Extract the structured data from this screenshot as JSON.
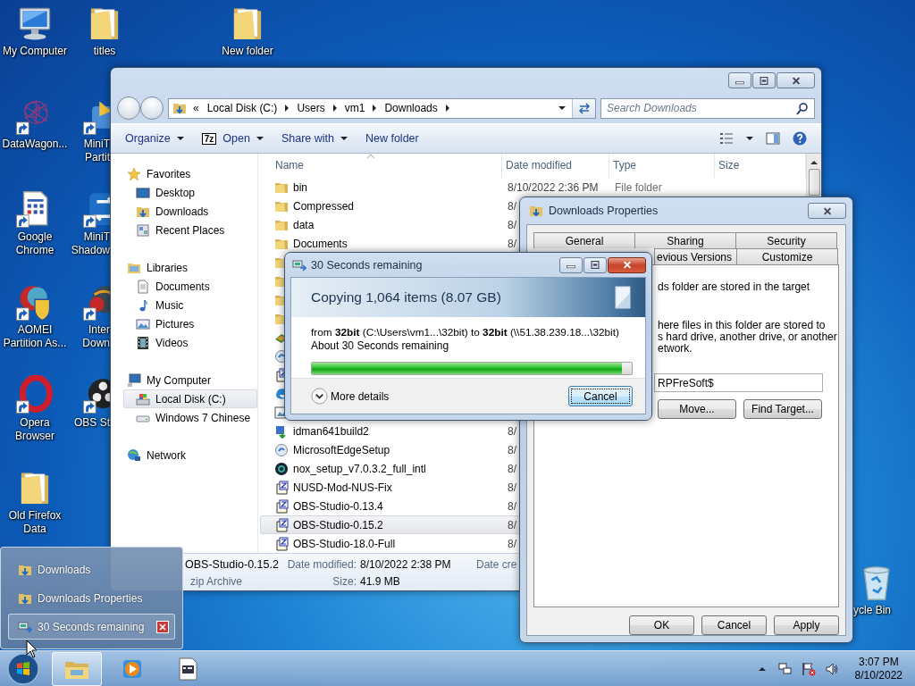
{
  "desktop": {
    "top_row": [
      {
        "label": "My Computer",
        "kind": "computer"
      },
      {
        "label": "titles",
        "kind": "folder"
      },
      {
        "label": "New folder",
        "kind": "folder"
      }
    ],
    "column_1": [
      {
        "label": "DataWagon...",
        "kind": "network-app"
      },
      {
        "label": "Google\nChrome",
        "kind": "document-app"
      },
      {
        "label": "AOMEI\nPartition As...",
        "kind": "shield-app"
      },
      {
        "label": "Opera\nBrowser",
        "kind": "ring-app"
      },
      {
        "label": "Old Firefox\nData",
        "kind": "folder"
      }
    ],
    "column_2": [
      {
        "label": "MiniT\nPartit",
        "kind": "wizard-app"
      },
      {
        "label": "MiniT\nShadow",
        "kind": "arrows-app"
      },
      {
        "label": "Inter\nDown",
        "kind": "globe-app"
      },
      {
        "label": "OBS St",
        "kind": "disc-app"
      }
    ],
    "recycle_bin": {
      "label": "ycle Bin"
    }
  },
  "explorer": {
    "breadcrumb_overflow": "«",
    "breadcrumb": [
      "Local Disk (C:)",
      "Users",
      "vm1",
      "Downloads"
    ],
    "search": {
      "placeholder": "Search Downloads"
    },
    "toolbar": [
      {
        "label": "Organize",
        "kind": "menu"
      },
      {
        "label": "Open",
        "kind": "open-menu",
        "badge": "7z"
      },
      {
        "label": "Share with",
        "kind": "menu"
      },
      {
        "label": "New folder",
        "kind": "plain"
      }
    ],
    "navigation_pane": [
      {
        "label": "Favorites",
        "kind": "star",
        "children": [
          {
            "label": "Desktop",
            "kind": "desktop",
            "selected": false
          },
          {
            "label": "Downloads",
            "kind": "downloads",
            "selected": false
          },
          {
            "label": "Recent Places",
            "kind": "recent",
            "selected": false
          }
        ]
      },
      {
        "label": "Libraries",
        "kind": "libraries",
        "children": [
          {
            "label": "Documents",
            "kind": "documents",
            "selected": false
          },
          {
            "label": "Music",
            "kind": "music",
            "selected": false
          },
          {
            "label": "Pictures",
            "kind": "pictures",
            "selected": false
          },
          {
            "label": "Videos",
            "kind": "videos",
            "selected": false
          }
        ]
      },
      {
        "label": "My Computer",
        "kind": "computer",
        "children": [
          {
            "label": "Local Disk (C:)",
            "kind": "disk",
            "selected": true
          },
          {
            "label": "Windows 7 Chinese",
            "kind": "drive",
            "selected": false
          }
        ]
      },
      {
        "label": "Network",
        "kind": "network"
      }
    ],
    "file_list": {
      "columns": [
        "Name",
        "Date modified",
        "Type",
        "Size"
      ],
      "rows": [
        {
          "name": "bin",
          "date": "8/10/2022 2:36 PM",
          "type": "File folder",
          "kind": "folder",
          "selected": false
        },
        {
          "name": "Compressed",
          "date": "8/",
          "kind": "folder",
          "selected": false
        },
        {
          "name": "data",
          "date": "8/",
          "kind": "folder",
          "selected": false
        },
        {
          "name": "Documents",
          "date": "8/",
          "kind": "folder",
          "selected": false
        },
        {
          "kind": "folder",
          "selected": false
        },
        {
          "kind": "folder",
          "selected": false
        },
        {
          "kind": "folder",
          "selected": false
        },
        {
          "kind": "folder",
          "selected": false
        },
        {
          "kind": "app",
          "selected": false
        },
        {
          "kind": "setup",
          "selected": false
        },
        {
          "kind": "zip",
          "selected": false
        },
        {
          "kind": "edge",
          "selected": false
        },
        {
          "kind": "image",
          "selected": false
        },
        {
          "name": "idman641build2",
          "date": "8/",
          "kind": "idm",
          "selected": false
        },
        {
          "name": "MicrosoftEdgeSetup",
          "date": "8/",
          "kind": "setup",
          "selected": false
        },
        {
          "name": "nox_setup_v7.0.3.2_full_intl",
          "date": "8/",
          "kind": "nox",
          "selected": false
        },
        {
          "name": "NUSD-Mod-NUS-Fix",
          "date": "8/",
          "kind": "zip",
          "selected": false
        },
        {
          "name": "OBS-Studio-0.13.4",
          "date": "8/",
          "kind": "zip",
          "selected": false
        },
        {
          "name": "OBS-Studio-0.15.2",
          "date": "8/",
          "kind": "zip",
          "selected": true
        },
        {
          "name": "OBS-Studio-18.0-Full",
          "date": "8/",
          "kind": "zip",
          "selected": false
        }
      ]
    },
    "details_pane": {
      "name": "OBS-Studio-0.15.2",
      "type": "zip Archive",
      "fields": [
        {
          "label": "Date modified:",
          "value": "8/10/2022 2:38 PM"
        },
        {
          "label": "Size:",
          "value": "41.9 MB"
        }
      ],
      "cut_label": "Date cre"
    }
  },
  "properties_dialog": {
    "title": "Downloads Properties",
    "tabs_row_1": [
      {
        "label": "General",
        "selected": false
      },
      {
        "label": "Sharing",
        "selected": false
      },
      {
        "label": "Security",
        "selected": false
      }
    ],
    "tabs_row_2": [
      {
        "label": "evious Versions",
        "selected": false
      },
      {
        "label": "Customize",
        "selected": false
      }
    ],
    "description": "ds folder are stored in the target",
    "instructions": "here files in this folder are stored to\ns hard drive, another drive, or another\network.",
    "location_field": {
      "value": "RPFreSoft$"
    },
    "location_buttons": [
      "Move...",
      "Find Target..."
    ],
    "buttons": [
      "OK",
      "Cancel",
      "Apply"
    ]
  },
  "copy_dialog": {
    "title": "30 Seconds remaining",
    "heading": "Copying 1,064 items (8.07 GB)",
    "route": "from **32bit** (C:\\Users\\vm1...\\32bit) to **32bit** (\\\\51.38.239.18...\\32bit)",
    "time_left": "About 30 Seconds remaining",
    "level": 0.97,
    "details_toggle": {
      "label": "More details",
      "expanded": false
    },
    "cancel_button": "Cancel"
  },
  "jump_list": [
    {
      "label": "Downloads",
      "kind": "folder",
      "selected": false
    },
    {
      "label": "Downloads Properties",
      "kind": "folder",
      "selected": false
    },
    {
      "label": "30 Seconds remaining",
      "kind": "copy",
      "selected": true
    }
  ],
  "taskbar": {
    "buttons": [
      {
        "kind": "explorer",
        "selected": true
      },
      {
        "kind": "media-player",
        "selected": false
      },
      {
        "kind": "window-app",
        "selected": false
      }
    ],
    "clock": {
      "time": "3:07 PM",
      "date": "8/10/2022"
    }
  }
}
